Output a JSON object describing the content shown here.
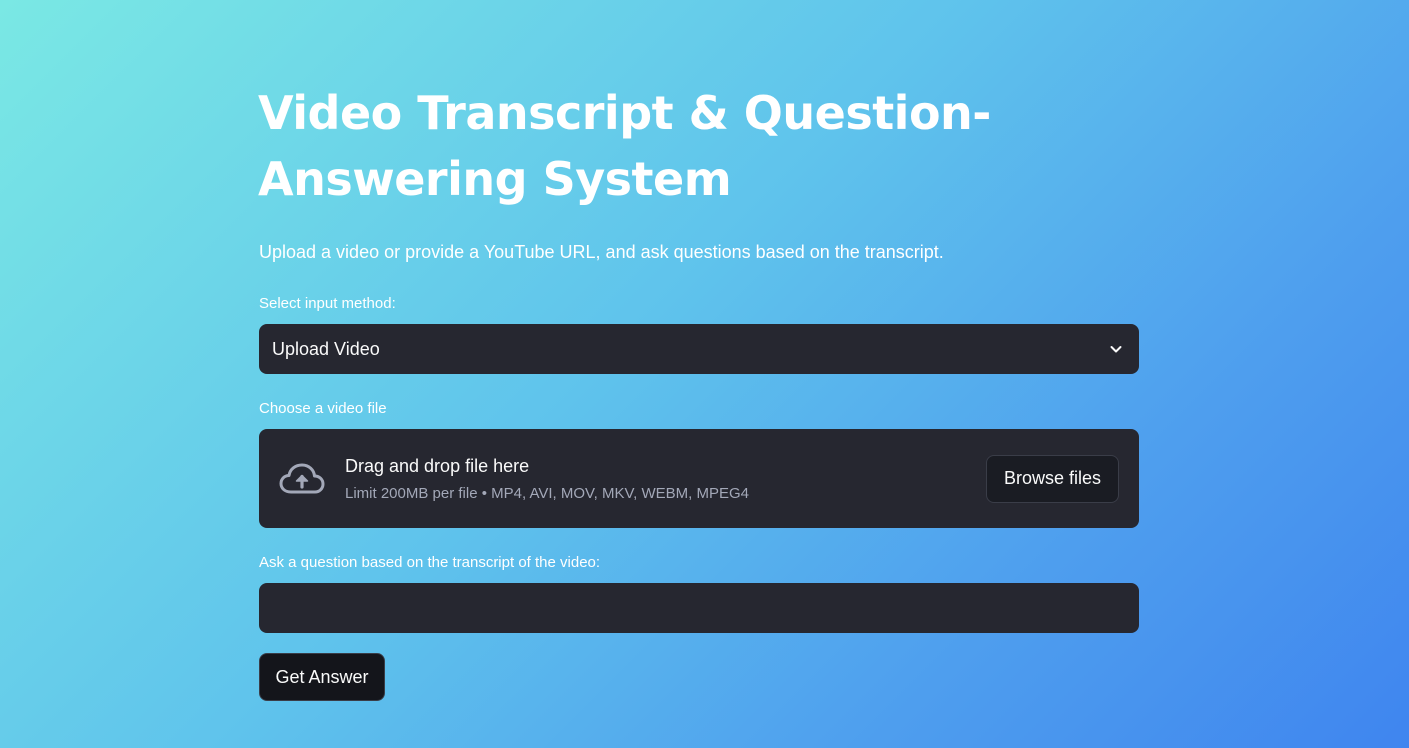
{
  "header": {
    "title_line1": "Video Transcript & Question-",
    "title_line2": "Answering System",
    "subtitle": "Upload a video or provide a YouTube URL, and ask questions based on the transcript."
  },
  "input_method": {
    "label": "Select input method:",
    "selected": "Upload Video",
    "icon": "chevron-down-icon"
  },
  "file_upload": {
    "label": "Choose a video file",
    "icon": "cloud-upload-icon",
    "drop_text": "Drag and drop file here",
    "limit_text": "Limit 200MB per file • MP4, AVI, MOV, MKV, WEBM, MPEG4",
    "browse_label": "Browse files"
  },
  "question": {
    "label": "Ask a question based on the transcript of the video:",
    "value": "",
    "placeholder": ""
  },
  "actions": {
    "get_answer_label": "Get Answer"
  },
  "colors": {
    "background_gradient_start": "#7ae8e4",
    "background_gradient_end": "#3f85ef",
    "widget_background": "#262730",
    "button_background": "#14151b",
    "text_primary": "#ffffff",
    "text_muted": "#a3a8b8"
  }
}
